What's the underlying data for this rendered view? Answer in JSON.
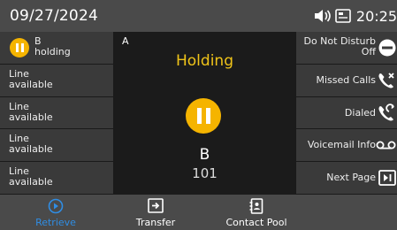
{
  "status_bar": {
    "date": "09/27/2024",
    "time": "20:25",
    "icons": [
      "speaker-icon",
      "screen-icon"
    ]
  },
  "left_keys": [
    {
      "line1": "B",
      "line2": "holding",
      "icon": "hold-icon"
    },
    {
      "line1": "Line",
      "line2": "available"
    },
    {
      "line1": "Line",
      "line2": "available"
    },
    {
      "line1": "Line",
      "line2": "available"
    },
    {
      "line1": "Line",
      "line2": "available"
    }
  ],
  "call": {
    "line_label": "A",
    "state": "Holding",
    "name": "B",
    "number": "101"
  },
  "right_keys": [
    {
      "line1": "Do Not Disturb",
      "line2": "Off",
      "icon": "dnd-icon"
    },
    {
      "label": "Missed Calls",
      "icon": "missed-call-icon"
    },
    {
      "label": "Dialed",
      "icon": "dialed-call-icon"
    },
    {
      "label": "Voicemail Info",
      "icon": "voicemail-icon"
    },
    {
      "label": "Next Page",
      "icon": "next-page-icon"
    }
  ],
  "softkeys": [
    {
      "label": "Retrieve",
      "icon": "play-icon",
      "color": "#2f8de4"
    },
    {
      "label": "Transfer",
      "icon": "transfer-icon",
      "color": "#ffffff"
    },
    {
      "label": "Contact Pool",
      "icon": "contacts-icon",
      "color": "#ffffff"
    }
  ],
  "colors": {
    "hold": "#f5b400",
    "state_text": "#f0c419",
    "accent": "#2f8de4"
  }
}
